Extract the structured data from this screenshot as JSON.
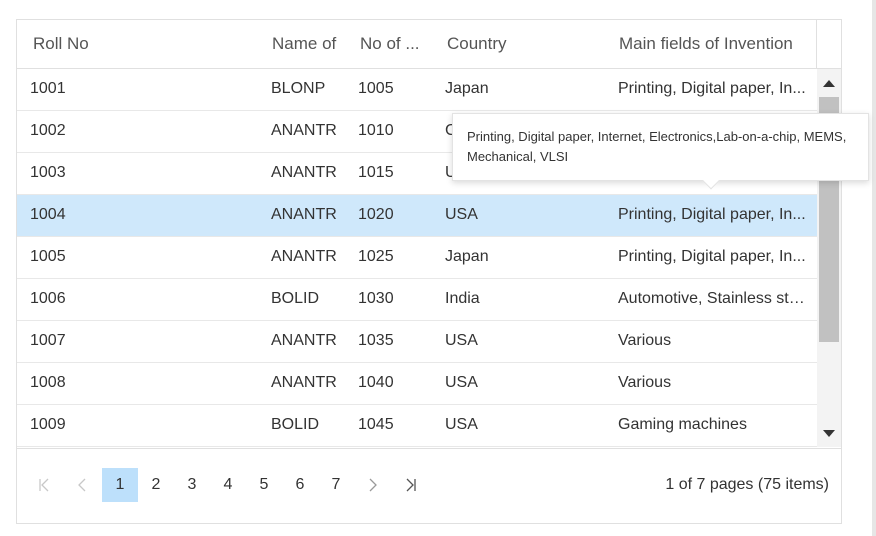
{
  "columns": {
    "roll_no": "Roll No",
    "name_of": "Name of",
    "no_of": "No of ...",
    "country": "Country",
    "main_fields": "Main fields of Invention"
  },
  "rows": [
    {
      "roll": "1001",
      "name": "BLONP",
      "no": "1005",
      "country": "Japan",
      "main": "Printing, Digital paper, In..."
    },
    {
      "roll": "1002",
      "name": "ANANTR",
      "no": "1010",
      "country": "C",
      "main": ""
    },
    {
      "roll": "1003",
      "name": "ANANTR",
      "no": "1015",
      "country": "U",
      "main": ""
    },
    {
      "roll": "1004",
      "name": "ANANTR",
      "no": "1020",
      "country": "USA",
      "main": "Printing, Digital paper, In..."
    },
    {
      "roll": "1005",
      "name": "ANANTR",
      "no": "1025",
      "country": "Japan",
      "main": "Printing, Digital paper, In..."
    },
    {
      "roll": "1006",
      "name": "BOLID",
      "no": "1030",
      "country": "India",
      "main": "Automotive, Stainless ste..."
    },
    {
      "roll": "1007",
      "name": "ANANTR",
      "no": "1035",
      "country": "USA",
      "main": "Various"
    },
    {
      "roll": "1008",
      "name": "ANANTR",
      "no": "1040",
      "country": "USA",
      "main": "Various"
    },
    {
      "roll": "1009",
      "name": "BOLID",
      "no": "1045",
      "country": "USA",
      "main": "Gaming machines"
    }
  ],
  "selected_row_roll": "1004",
  "tooltip": {
    "text": "Printing, Digital paper, Internet, Electronics,Lab-on-a-chip, MEMS, Mechanical, VLSI"
  },
  "pager": {
    "pages": [
      "1",
      "2",
      "3",
      "4",
      "5",
      "6",
      "7"
    ],
    "current_page": "1",
    "info": "1 of 7 pages (75 items)",
    "icons": {
      "first": "first-page-icon",
      "prev": "previous-page-icon",
      "next": "next-page-icon",
      "last": "last-page-icon"
    }
  },
  "colors": {
    "selected_row": "#cfe8fb",
    "active_page": "#bde0fb",
    "border": "#e0e0e0",
    "scroll_thumb": "#c1c1c1"
  }
}
